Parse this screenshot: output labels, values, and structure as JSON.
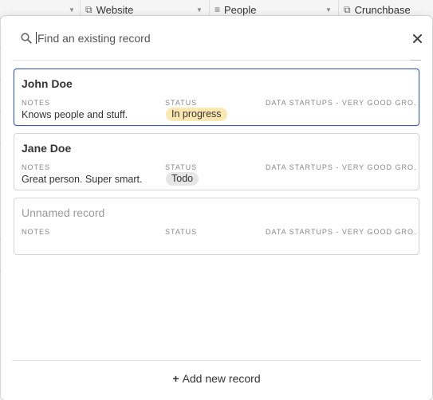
{
  "table_header": {
    "columns": [
      {
        "label": "Website",
        "icon": "link-icon"
      },
      {
        "label": "People",
        "icon": "linked-records-icon"
      },
      {
        "label": "Crunchbase",
        "icon": "link-icon"
      }
    ]
  },
  "search": {
    "placeholder": "Find an existing record"
  },
  "field_labels": {
    "notes": "NOTES",
    "status": "STATUS",
    "data": "DATA STARTUPS - VERY GOOD GRO..."
  },
  "records": [
    {
      "title": "John Doe",
      "notes": "Knows people and stuff.",
      "status": "In progress",
      "status_color": "#fbe8b0",
      "selected": true
    },
    {
      "title": "Jane Doe",
      "notes": "Great person. Super smart.",
      "status": "Todo",
      "status_color": "#e6e6e6",
      "selected": false
    },
    {
      "title": "Unnamed record",
      "notes": "",
      "status": "",
      "status_color": "",
      "selected": false
    }
  ],
  "footer": {
    "add_label": "Add new record"
  },
  "colors": {
    "selected_border": "#3a5aa8"
  }
}
